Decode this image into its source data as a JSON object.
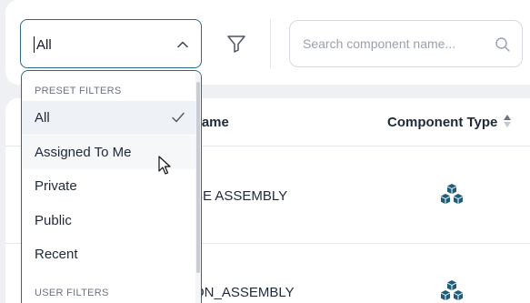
{
  "toolbar": {
    "selected_filter": "All",
    "search_placeholder": "Search component name..."
  },
  "dropdown": {
    "preset_label": "PRESET FILTERS",
    "options": [
      {
        "label": "All",
        "selected": true
      },
      {
        "label": "Assigned To Me",
        "hovered": true
      },
      {
        "label": "Private"
      },
      {
        "label": "Public"
      },
      {
        "label": "Recent"
      }
    ],
    "user_label": "USER FILTERS"
  },
  "table": {
    "columns": [
      {
        "label": "onent Name"
      },
      {
        "label": "Component Type"
      }
    ],
    "rows": [
      {
        "name": "SE ASSEMBLY",
        "type_icon": "assembly-cubes-icon"
      },
      {
        "name": "ON_ASSEMBLY",
        "type_icon": "assembly-cubes-icon"
      }
    ]
  },
  "colors": {
    "accent_border": "#2a6b86",
    "cube_icon": "#1f5e78"
  }
}
